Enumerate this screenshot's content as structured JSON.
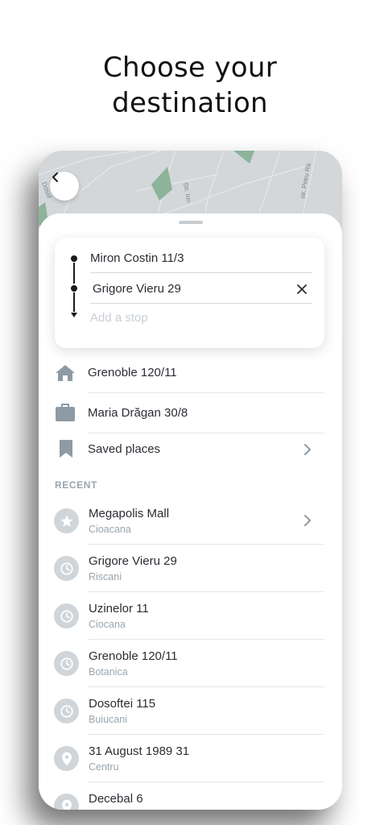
{
  "headline": {
    "line1": "Choose your",
    "line2": "destination"
  },
  "map": {
    "street_labels": [
      "Str. Ion",
      "str. Petru Ra",
      "Dosof"
    ]
  },
  "route": {
    "origin": "Miron Costin 11/3",
    "destination": "Grigore Vieru 29",
    "add_stop_placeholder": "Add a stop"
  },
  "saved": [
    {
      "icon": "home-icon",
      "label": "Grenoble 120/11"
    },
    {
      "icon": "briefcase-icon",
      "label": "Maria Drăgan 30/8"
    },
    {
      "icon": "bookmark-icon",
      "label": "Saved places"
    }
  ],
  "recent": {
    "heading": "RECENT",
    "items": [
      {
        "icon": "star-icon",
        "title": "Megapolis Mall",
        "subtitle": "Cioacana"
      },
      {
        "icon": "clock-icon",
        "title": "Grigore Vieru 29",
        "subtitle": "Riscani"
      },
      {
        "icon": "clock-icon",
        "title": "Uzinelor 11",
        "subtitle": "Ciocana"
      },
      {
        "icon": "clock-icon",
        "title": "Grenoble 120/11",
        "subtitle": "Botanica"
      },
      {
        "icon": "clock-icon",
        "title": "Dosoftei 115",
        "subtitle": "Buiucani"
      },
      {
        "icon": "location-pin-icon",
        "title": "31 August 1989 31",
        "subtitle": "Centru"
      },
      {
        "icon": "location-pin-icon",
        "title": "Decebal 6",
        "subtitle": ""
      }
    ]
  },
  "colors": {
    "icon_gray": "#8e9aa4",
    "circle_bg": "#d0d5d9",
    "map_bg": "#d3d7da",
    "map_green": "#8db39a",
    "text_primary": "#2a2d33",
    "text_secondary": "#9aa6ae"
  }
}
